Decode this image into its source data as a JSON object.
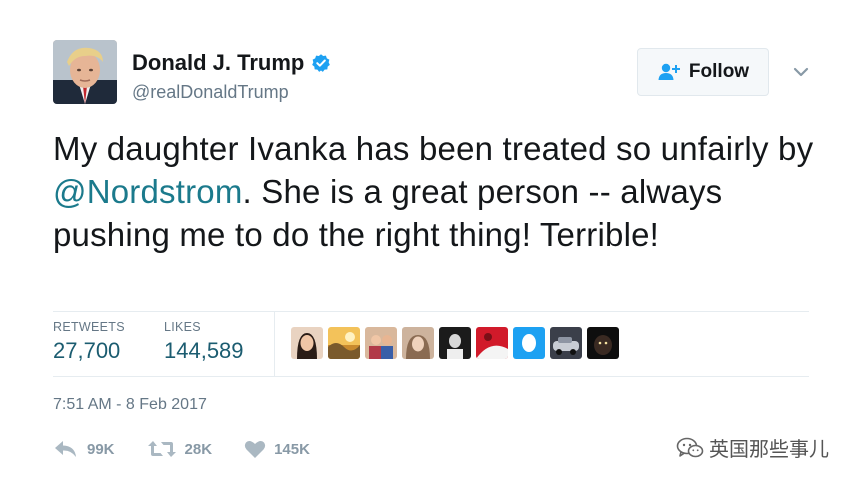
{
  "author": {
    "name": "Donald J. Trump",
    "handle": "@realDonaldTrump",
    "verified": true
  },
  "follow_button": {
    "label": "Follow"
  },
  "tweet": {
    "text_before": "My daughter Ivanka has been treated so unfairly by ",
    "mention": "@Nordstrom",
    "text_after": ". She is a great person -- always pushing me to do the right thing! Terrible!"
  },
  "stats": {
    "retweets_label": "RETWEETS",
    "retweets_value": "27,700",
    "likes_label": "LIKES",
    "likes_value": "144,589"
  },
  "timestamp": "7:51 AM - 8 Feb 2017",
  "actions": {
    "reply_count": "99K",
    "retweet_count": "28K",
    "like_count": "145K"
  },
  "watermark": {
    "text": "英国那些事儿"
  },
  "colors": {
    "accent": "#1da1f2",
    "mention": "#1b7a8c",
    "stat_value": "#1b5c70",
    "muted": "#657786",
    "action_gray": "#8899a6"
  },
  "icons": {
    "verified": "verified-badge-icon",
    "follow": "add-user-icon",
    "caret": "chevron-down-icon",
    "reply": "reply-icon",
    "retweet": "retweet-icon",
    "like": "heart-icon",
    "watermark": "wechat-logo-icon"
  }
}
